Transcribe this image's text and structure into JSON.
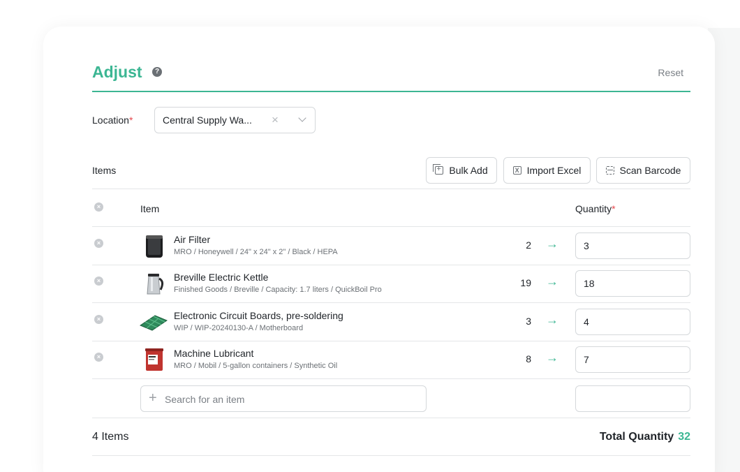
{
  "header": {
    "title": "Adjust",
    "help_icon": "question-circle-icon",
    "reset_label": "Reset"
  },
  "location": {
    "label": "Location",
    "required_mark": "*",
    "value": "Central Supply Wa...",
    "clear_icon": "close-icon",
    "chevron_icon": "chevron-down-icon"
  },
  "items_section": {
    "label": "Items",
    "buttons": [
      {
        "label": "Bulk Add",
        "icon": "bulk-add-icon"
      },
      {
        "label": "Import Excel",
        "icon": "excel-icon"
      },
      {
        "label": "Scan Barcode",
        "icon": "barcode-scan-icon"
      }
    ]
  },
  "table": {
    "columns": {
      "item": "Item",
      "quantity": "Quantity",
      "required_mark": "*"
    },
    "rows": [
      {
        "name": "Air Filter",
        "path": "MRO / Honeywell / 24\" x 24\" x 2\" / Black / HEPA",
        "current": "2",
        "new": "3",
        "thumb": "air-filter"
      },
      {
        "name": "Breville Electric Kettle",
        "path": "Finished Goods / Breville / Capacity: 1.7 liters / QuickBoil Pro",
        "current": "19",
        "new": "18",
        "thumb": "kettle"
      },
      {
        "name": "Electronic Circuit Boards, pre-soldering",
        "path": "WIP / WIP-20240130-A / Motherboard",
        "current": "3",
        "new": "4",
        "thumb": "circuit-board"
      },
      {
        "name": "Machine Lubricant",
        "path": "MRO / Mobil / 5-gallon containers / Synthetic Oil",
        "current": "8",
        "new": "7",
        "thumb": "lubricant-bucket"
      }
    ],
    "search_placeholder": "Search for an item",
    "arrow_glyph": "→",
    "remove_glyph": "×"
  },
  "footer": {
    "items_count": "4 Items",
    "total_label": "Total Quantity",
    "total_value": "32"
  },
  "colors": {
    "accent": "#3cb693",
    "required": "#e5484d",
    "border": "#d5d8db"
  }
}
